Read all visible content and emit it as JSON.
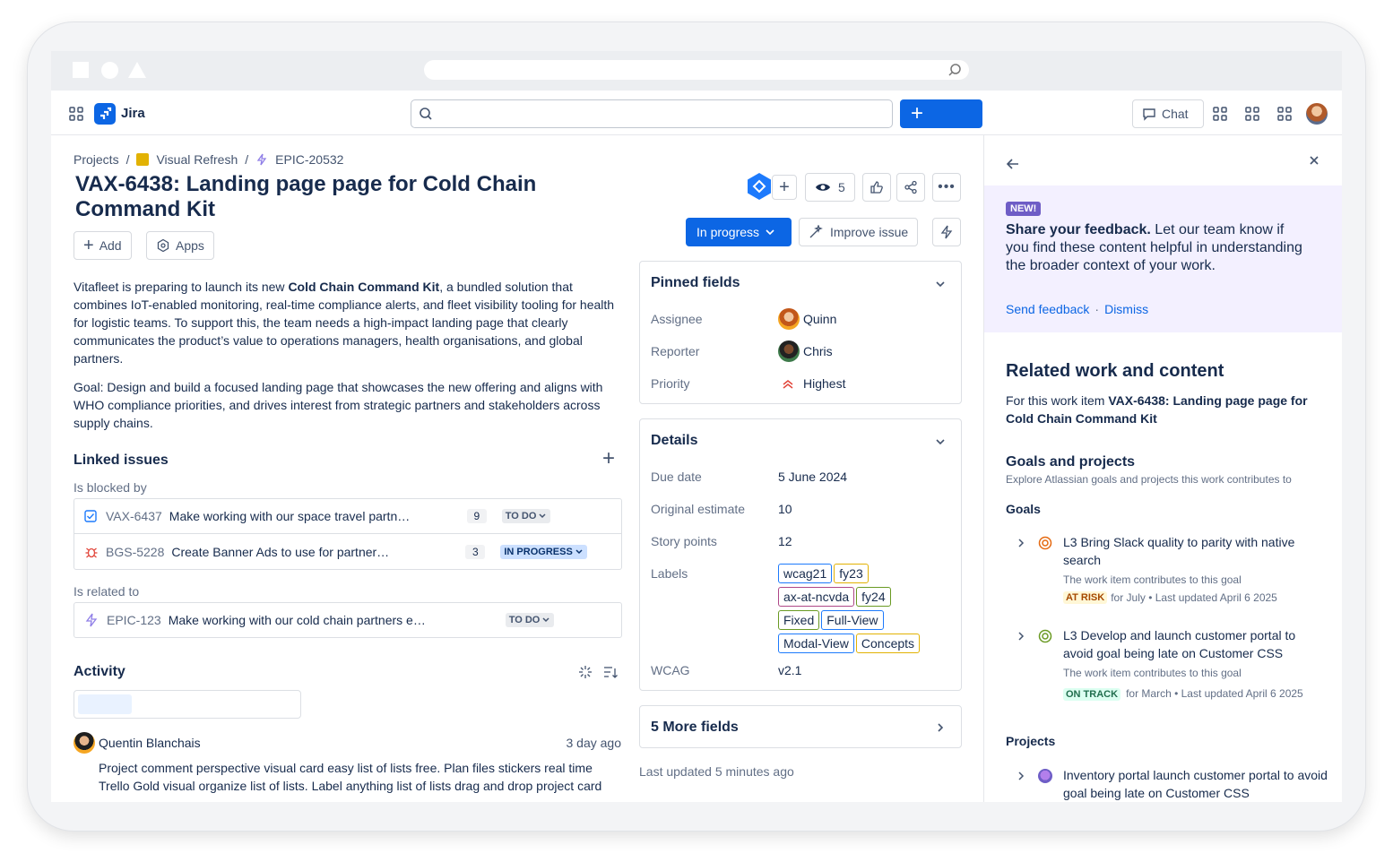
{
  "app": {
    "name": "Jira",
    "create_label": "+",
    "chat_label": "Chat"
  },
  "breadcrumb": {
    "projects": "Projects",
    "project": "Visual Refresh",
    "epic": "EPIC-20532"
  },
  "issue": {
    "title_line1": "VAX-6438: Landing page page for Cold Chain",
    "title_line2": "Command Kit",
    "add_label": "Add",
    "apps_label": "Apps",
    "watchers": "5",
    "status": "In progress",
    "improve_label": "Improve issue",
    "desc1_pre": "Vitafleet is preparing to launch its new ",
    "desc1_bold": "Cold Chain Command Kit",
    "desc1_post": ", a bundled solution that combines IoT-enabled monitoring, real-time compliance alerts, and fleet visibility tooling for health for logistic teams. To support this, the team needs a high-impact landing page that clearly communicates the product’s value to operations managers, health organisations, and global partners.",
    "desc2": "Goal: Design and build a focused landing page that showcases the new offering and aligns with WHO compliance priorities, and drives interest from strategic partners and stakeholders across supply chains."
  },
  "linked": {
    "title": "Linked issues",
    "blocked_by": "Is blocked by",
    "related_to": "Is related to",
    "items": [
      {
        "key": "VAX-6437",
        "summary": "Make working with our space travel partn…",
        "count": "9",
        "status": "TO DO"
      },
      {
        "key": "BGS-5228",
        "summary": "Create Banner Ads to use for partner…",
        "count": "3",
        "status": "IN PROGRESS"
      },
      {
        "key": "EPIC-123",
        "summary": "Make working with our cold chain partners e…",
        "count": "",
        "status": "TO DO"
      }
    ]
  },
  "activity": {
    "title": "Activity",
    "author": "Quentin Blanchais",
    "time": "3 day ago",
    "comment": "Project comment perspective visual card easy list of lists free. Plan files stickers real time Trello Gold visual organize list of lists. Label anything list of lists drag and drop project card Power-Ups organize"
  },
  "pinned": {
    "title": "Pinned fields",
    "assignee_label": "Assignee",
    "assignee": "Quinn",
    "reporter_label": "Reporter",
    "reporter": "Chris",
    "priority_label": "Priority",
    "priority": "Highest"
  },
  "details": {
    "title": "Details",
    "due_label": "Due date",
    "due": "5 June 2024",
    "estimate_label": "Original estimate",
    "estimate": "10",
    "points_label": "Story points",
    "points": "12",
    "labels_label": "Labels",
    "labels": [
      "wcag21",
      "fy23",
      "ax-at-ncvda",
      "fy24",
      "Fixed",
      "Full-View",
      "Modal-View",
      "Concepts"
    ],
    "wcag_label": "WCAG",
    "wcag": "v2.1"
  },
  "more_fields": "5 More fields",
  "last_updated": "Last updated 5 minutes ago",
  "sidebar": {
    "new_badge": "NEW!",
    "feedback_bold": "Share your feedback.",
    "feedback_text": " Let our team know if you find these content helpful in understanding the broader context of your work.",
    "send_feedback": "Send feedback",
    "dismiss": "Dismiss",
    "related_title": "Related work and content",
    "related_pre": "For this work item ",
    "related_bold": "VAX-6438: Landing page page for Cold Chain Command Kit",
    "gp_title": "Goals and projects",
    "gp_sub": "Explore Atlassian goals and projects this work contributes to",
    "goals_label": "Goals",
    "goals": [
      {
        "title": "L3 Bring Slack quality to parity with native search",
        "note": "The work item contributes to this goal",
        "status": "AT RISK",
        "meta": "for July • Last updated April 6 2025"
      },
      {
        "title": "L3 Develop and launch customer portal to avoid goal being late on Customer CSS",
        "note": "The work item contributes to this goal",
        "status": "ON TRACK",
        "meta": "for March • Last updated April 6 2025"
      }
    ],
    "projects_label": "Projects",
    "project_title": "Inventory portal launch customer portal to avoid goal being late on Customer CSS"
  },
  "colors": {
    "brand": "#0c66e4",
    "status_bg": "#0c66e4",
    "feedback_bg": "#f3f0ff",
    "new_badge": "#6e5dc6"
  }
}
